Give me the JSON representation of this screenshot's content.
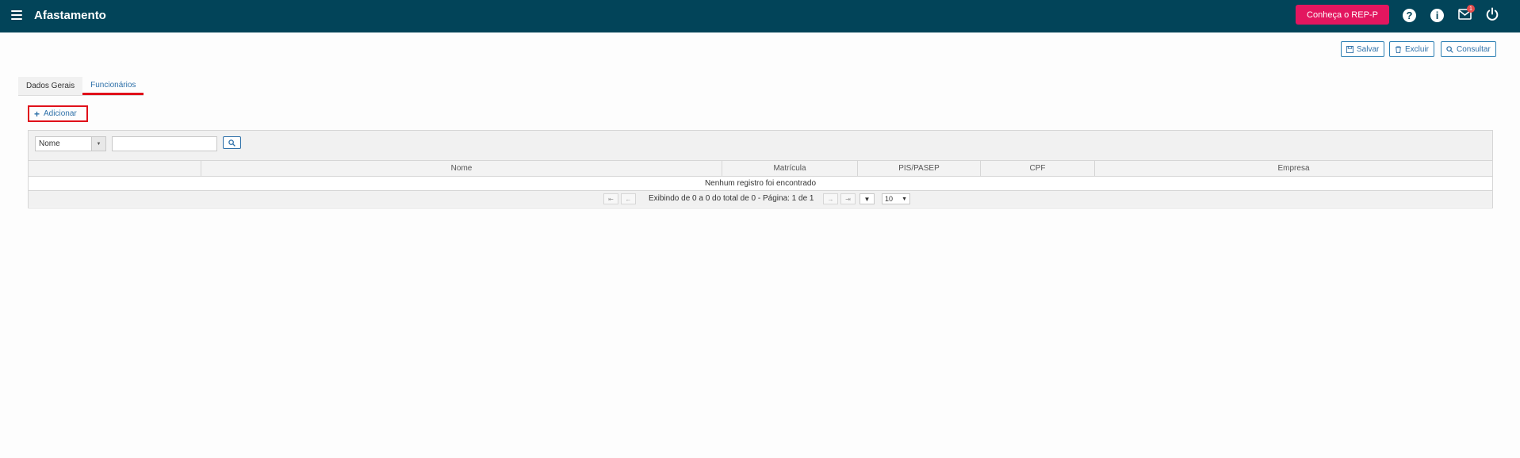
{
  "header": {
    "title": "Afastamento",
    "rep_button": "Conheça o REP-P",
    "help_icon": "?",
    "info_icon": "i",
    "notification_count": "1"
  },
  "toolbar": {
    "save": "Salvar",
    "delete": "Excluir",
    "search": "Consultar"
  },
  "tabs": [
    {
      "label": "Dados Gerais",
      "active": false
    },
    {
      "label": "Funcionários",
      "active": true
    }
  ],
  "add_button": "Adicionar",
  "grid": {
    "filter_select": "Nome",
    "columns": [
      "Nome",
      "Matrícula",
      "PIS/PASEP",
      "CPF",
      "Empresa"
    ],
    "empty_message": "Nenhum registro foi encontrado",
    "pager_text": "Exibindo de 0 a 0 do total de 0 - Página: 1 de 1",
    "page_size": "10"
  },
  "colors": {
    "topbar": "#024459",
    "rep_button": "#e3165f",
    "accent": "#2c6fa8",
    "highlight": "#e0101a"
  }
}
